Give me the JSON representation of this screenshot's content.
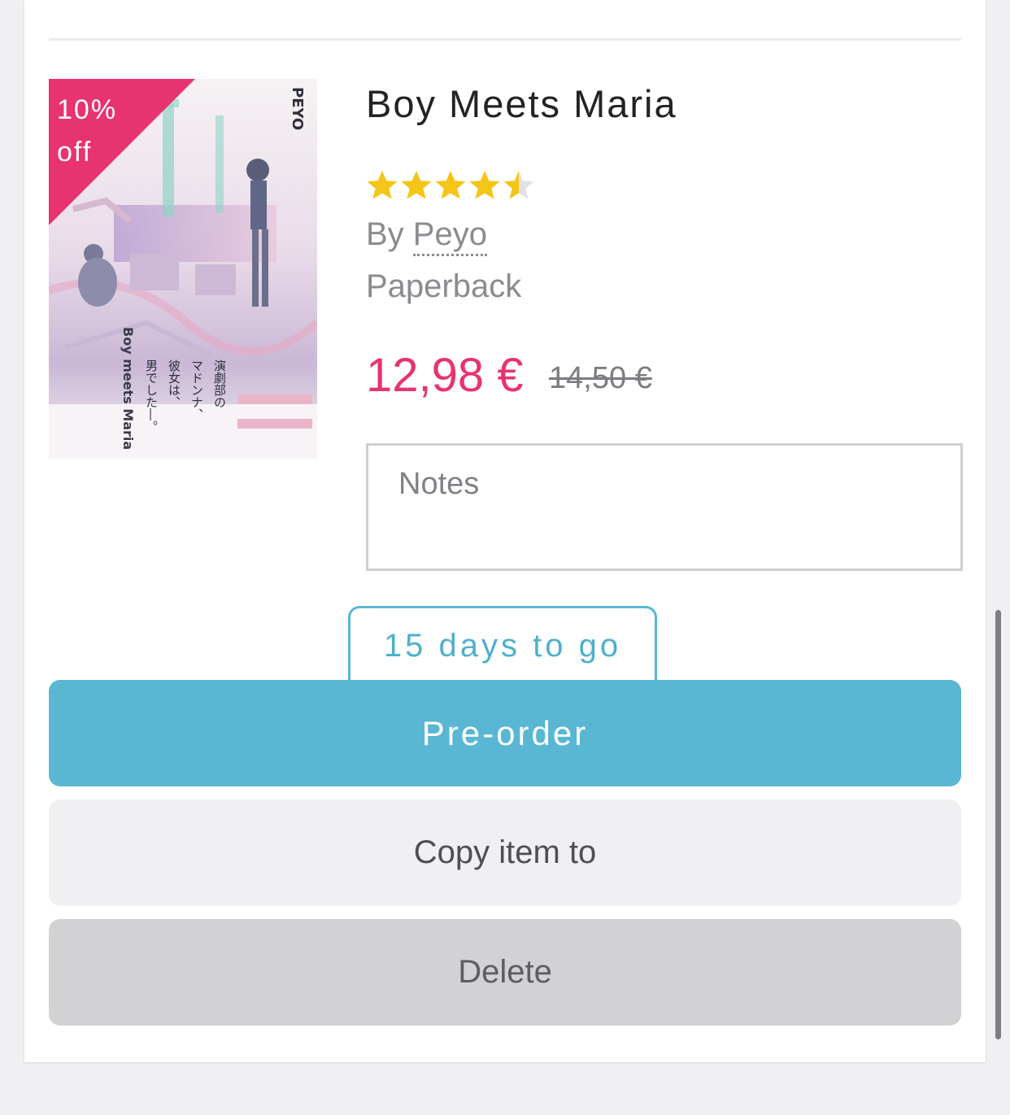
{
  "product": {
    "title": "Boy Meets Maria",
    "rating": 4.5,
    "rating_max": 5,
    "author_prefix": "By ",
    "author": "Peyo",
    "format": "Paperback",
    "price": "12,98 €",
    "old_price": "14,50 €",
    "discount_badge": "10%\noff",
    "cover": {
      "author_mark": "PEYO",
      "title_mark": "Boy meets Maria",
      "jp_tagline_1": "演劇部の",
      "jp_tagline_2": "マドンナ、",
      "jp_tagline_3": "彼女は、",
      "jp_tagline_4": "男でした―。"
    }
  },
  "notes": {
    "placeholder": "Notes"
  },
  "release": {
    "countdown": "15 days to go"
  },
  "actions": {
    "preorder_label": "Pre-order",
    "copy_label": "Copy item to",
    "delete_label": "Delete"
  },
  "colors": {
    "accent": "#59b7d4",
    "price": "#e7336f",
    "star": "#f5c518",
    "star_empty": "#e2e2e4"
  }
}
